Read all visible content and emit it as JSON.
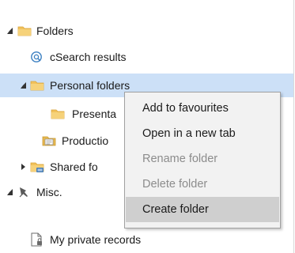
{
  "tree": {
    "items": [
      {
        "label": "Folders",
        "icon": "folder-icon",
        "expanded": true
      },
      {
        "label": "cSearch results",
        "icon": "search-results-icon"
      },
      {
        "label": "Personal folders",
        "icon": "folder-icon",
        "expanded": true,
        "selected": true
      },
      {
        "label": "Presenta",
        "icon": "folder-icon"
      },
      {
        "label": "Productio",
        "icon": "production-folder-icon"
      },
      {
        "label": "Shared fo",
        "icon": "shared-folder-icon",
        "expanded": false
      },
      {
        "label": "Misc.",
        "icon": "pin-icon",
        "expanded": true
      },
      {
        "label": "My private records",
        "icon": "private-record-icon"
      }
    ]
  },
  "context_menu": {
    "items": [
      {
        "label": "Add to favourites",
        "enabled": true
      },
      {
        "label": "Open in a new tab",
        "enabled": true
      },
      {
        "label": "Rename folder",
        "enabled": false
      },
      {
        "label": "Delete folder",
        "enabled": false
      },
      {
        "label": "Create folder",
        "enabled": true,
        "hovered": true
      }
    ]
  },
  "colors": {
    "selection": "#cce0f7",
    "folder": "#f2c25c",
    "menu_bg": "#f2f2f2",
    "menu_hover": "#cfcfcf",
    "disabled_text": "#8c8c8c"
  }
}
